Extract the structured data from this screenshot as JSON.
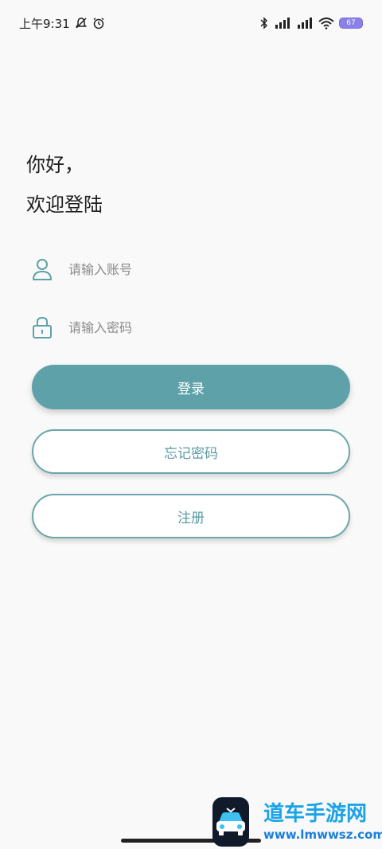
{
  "status_bar": {
    "time": "上午9:31",
    "battery": "67"
  },
  "greeting": {
    "line1": "你好，",
    "line2": "欢迎登陆"
  },
  "form": {
    "account_placeholder": "请输入账号",
    "password_placeholder": "请输入密码"
  },
  "buttons": {
    "login": "登录",
    "forgot_password": "忘记密码",
    "register": "注册"
  },
  "watermark": {
    "title": "道车手游网",
    "url": "www.lmwwsz.com"
  },
  "colors": {
    "accent": "#5ea1a8",
    "background": "#f9f9f9",
    "outline": "#6aa6ac"
  }
}
